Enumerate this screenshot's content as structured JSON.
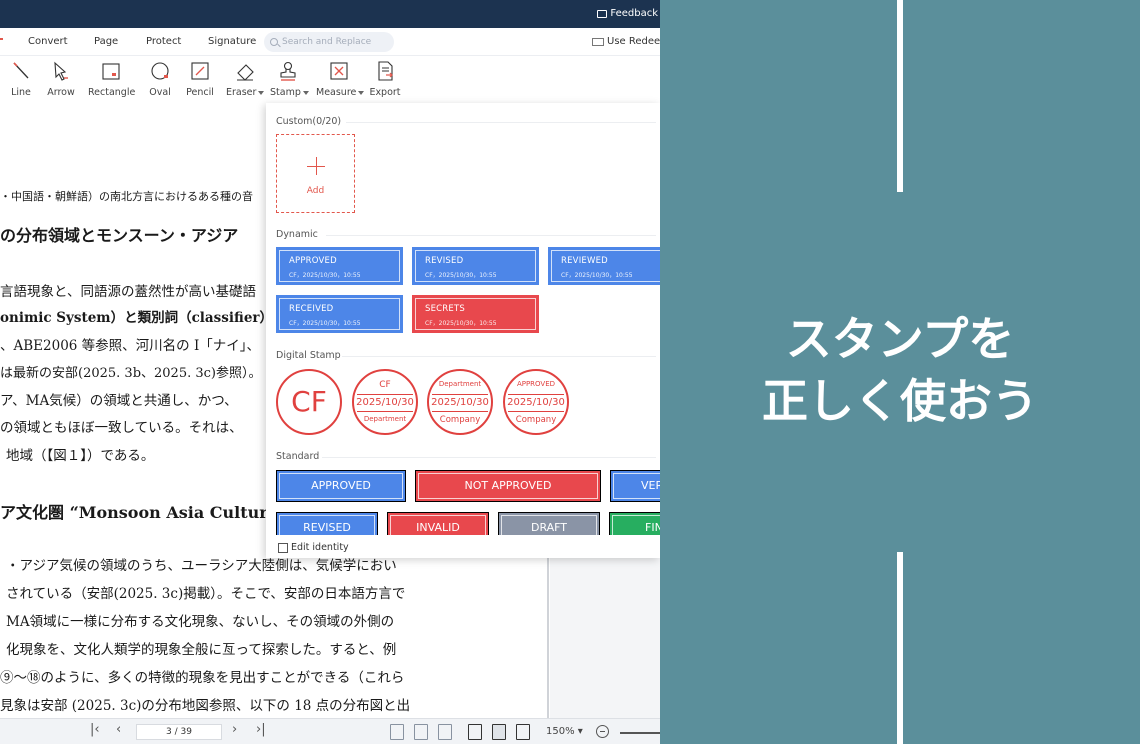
{
  "titlebar": {
    "feedback_label": "Feedback"
  },
  "menu": {
    "items": [
      "Convert",
      "Page",
      "Protect",
      "Signature"
    ],
    "search_placeholder": "Search and Replace",
    "redeem_label": "Use Redeem"
  },
  "toolbar": {
    "tools": [
      "Line",
      "Arrow",
      "Rectangle",
      "Oval",
      "Pencil",
      "Eraser",
      "Stamp",
      "Measure",
      "Export"
    ]
  },
  "document": {
    "lines": [
      "・中国語・朝鮮語）の南北方言におけるある種の音",
      "の分布領域とモンスーン・アジア",
      "言語現象と、同語源の蓋然性が高い基礎語",
      "onimic System）と類別詞（classifier）に",
      "、ABE2006 等参照、河川名の I「ナイ」、",
      "は最新の安部(2025. 3b、2025. 3c)参照）。",
      "ア、MA気候）の領域と共通し、かつ、",
      "の領域ともほぼ一致している。それは、",
      "地域（【図１】）である。",
      "ア文化圏 “Monsoon Asia Cultural",
      "・アジア気候の領域のうち、ユーラシア大陸側は、気候学におい",
      "されている（安部(2025. 3c)掲載）。そこで、安部の日本語方言で",
      "MA領域に一様に分布する文化現象、ないし、その領域の外側の",
      "化現象を、文化人類学的現象全般に亙って探索した。すると、例",
      "⑨〜⑱のように、多くの特徴的現象を見出すことができる（これら",
      "見象は安部 (2025. 3c)の分布地図参照、以下の 18 点の分布図と出"
    ]
  },
  "stamp_panel": {
    "custom_title": "Custom(0/20)",
    "add_label": "Add",
    "dynamic_title": "Dynamic",
    "dynamic": [
      {
        "label": "APPROVED",
        "sub": "CF，2025/10/30，10:55",
        "color": "blue"
      },
      {
        "label": "REVISED",
        "sub": "CF，2025/10/30，10:55",
        "color": "blue"
      },
      {
        "label": "REVIEWED",
        "sub": "CF，2025/10/30，10:55",
        "color": "blue"
      },
      {
        "label": "RECEIVED",
        "sub": "CF，2025/10/30，10:55",
        "color": "blue"
      },
      {
        "label": "SECRETS",
        "sub": "CF，2025/10/30，10:55",
        "color": "red"
      }
    ],
    "digital_title": "Digital Stamp",
    "digital": [
      {
        "big": "CF"
      },
      {
        "top": "CF",
        "date": "2025/10/30",
        "bottom": "Department"
      },
      {
        "top": "Department",
        "date": "2025/10/30",
        "bottom": "Company"
      },
      {
        "top": "APPROVED",
        "date": "2025/10/30",
        "bottom": "Company"
      }
    ],
    "standard_title": "Standard",
    "standard": [
      {
        "label": "APPROVED",
        "color": "blue"
      },
      {
        "label": "NOT APPROVED",
        "color": "red"
      },
      {
        "label": "VER",
        "color": "blue"
      },
      {
        "label": "REVISED",
        "color": "blue"
      },
      {
        "label": "INVALID",
        "color": "red"
      },
      {
        "label": "DRAFT",
        "color": "grey"
      },
      {
        "label": "FIN",
        "color": "green"
      }
    ],
    "edit_identity": "Edit identity"
  },
  "statusbar": {
    "page_indicator": "3 / 39",
    "zoom": "150%"
  },
  "overlay": {
    "line1": "スタンプを",
    "line2": "正しく使おう"
  },
  "colors": {
    "titlebar": "#1c3350",
    "background": "#5b8f9b",
    "stamp_blue": "#4d86e8",
    "stamp_red": "#e8484d",
    "stamp_grey": "#8a94a6",
    "stamp_green": "#27ae60",
    "accent_red": "#e2574c"
  }
}
